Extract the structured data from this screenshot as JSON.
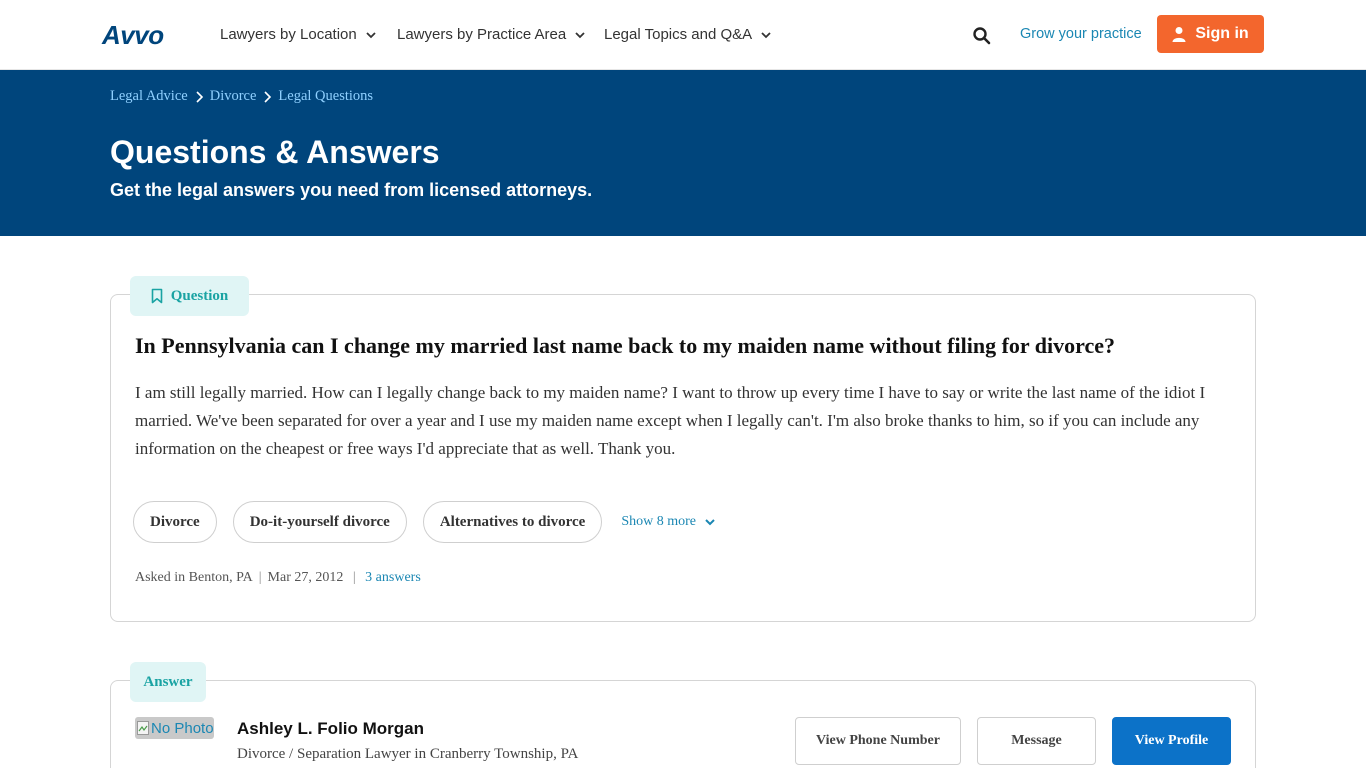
{
  "header": {
    "logo": "Avvo",
    "nav": [
      {
        "label": "Lawyers by Location"
      },
      {
        "label": "Lawyers by Practice Area"
      },
      {
        "label": "Legal Topics and Q&A"
      }
    ],
    "grow_label": "Grow your practice",
    "signin_label": "Sign in",
    "icons": {
      "search": "search-icon",
      "user": "user-icon",
      "chevron": "chevron-down-icon"
    },
    "colors": {
      "brand": "#00457c",
      "signin": "#f3662d",
      "link": "#1b87b3"
    }
  },
  "breadcrumb": [
    "Legal Advice",
    "Divorce",
    "Legal Questions"
  ],
  "hero": {
    "title": "Questions & Answers",
    "subtitle": "Get the legal answers you need from licensed attorneys."
  },
  "question": {
    "badge": "Question",
    "title": "In Pennsylvania can I change my married last name back to my maiden name without filing for divorce?",
    "body": "I am still legally married. How can I legally change back to my maiden name? I want to throw up every time I have to say or write the last name of the idiot I married. We've been separated for over a year and I use my maiden name except when I legally can't. I'm also broke thanks to him, so if you can include any information on the cheapest or free ways I'd appreciate that as well. Thank you.",
    "tags": [
      "Divorce",
      "Do-it-yourself divorce",
      "Alternatives to divorce"
    ],
    "show_more": "Show 8 more",
    "asked_in": "Asked in Benton, PA",
    "date": "Mar 27, 2012",
    "answers_count": "3 answers"
  },
  "answer": {
    "badge": "Answer",
    "photo_alt": "No Photo",
    "lawyer_name": "Ashley L. Folio Morgan",
    "specialty": "Divorce / Separation Lawyer in Cranberry Township, PA",
    "buttons": {
      "phone": "View Phone Number",
      "message": "Message",
      "profile": "View Profile"
    }
  }
}
